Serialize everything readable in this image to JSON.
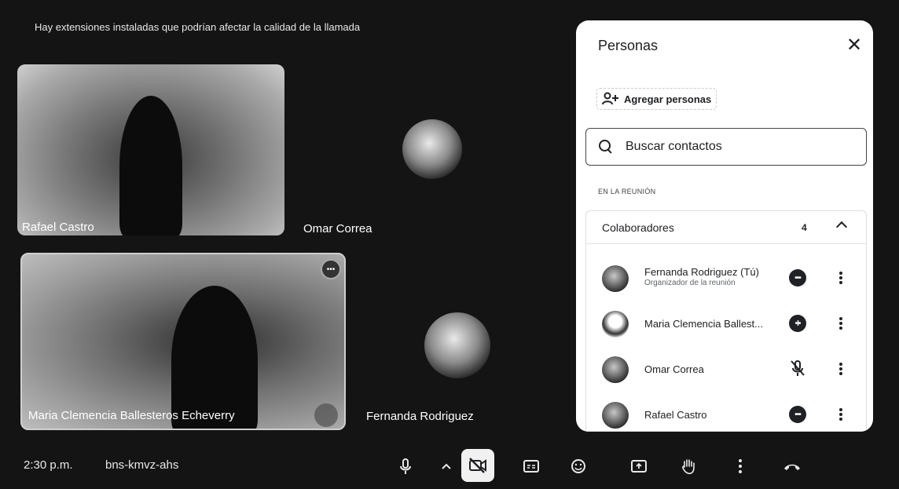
{
  "warning": {
    "text": "Hay extensiones instaladas que podrían afectar la calidad de la llamada"
  },
  "tiles": [
    {
      "name": "Rafael Castro",
      "kind": "video"
    },
    {
      "name": "Omar Correa",
      "kind": "avatar"
    },
    {
      "name": "Maria Clemencia Ballesteros Echeverry",
      "kind": "video",
      "selected": true
    },
    {
      "name": "Fernanda Rodriguez",
      "kind": "avatar"
    }
  ],
  "panel": {
    "title": "Personas",
    "add_label": "Agregar personas",
    "search_placeholder": "Buscar contactos",
    "section_label": "EN LA REUNIÓN",
    "group": {
      "label": "Colaboradores",
      "count": "4"
    },
    "people": [
      {
        "name": "Fernanda Rodriguez (Tú)",
        "role": "Organizador de la reunión",
        "status": "audio-level-icon"
      },
      {
        "name": "Maria Clemencia Ballest...",
        "role": "",
        "status": "audio-level-icon"
      },
      {
        "name": "Omar Correa",
        "role": "",
        "status": "mic-off-icon"
      },
      {
        "name": "Rafael Castro",
        "role": "",
        "status": "audio-level-icon"
      }
    ]
  },
  "bottom_bar": {
    "time": "2:30 p.m.",
    "meeting_code": "bns-kmvz-ahs",
    "controls": [
      "mic-icon",
      "chevron-up-icon",
      "camera-off-icon",
      "captions-icon",
      "emoji-icon",
      "present-icon",
      "raise-hand-icon",
      "more-options-icon",
      "leave-call-icon"
    ]
  }
}
